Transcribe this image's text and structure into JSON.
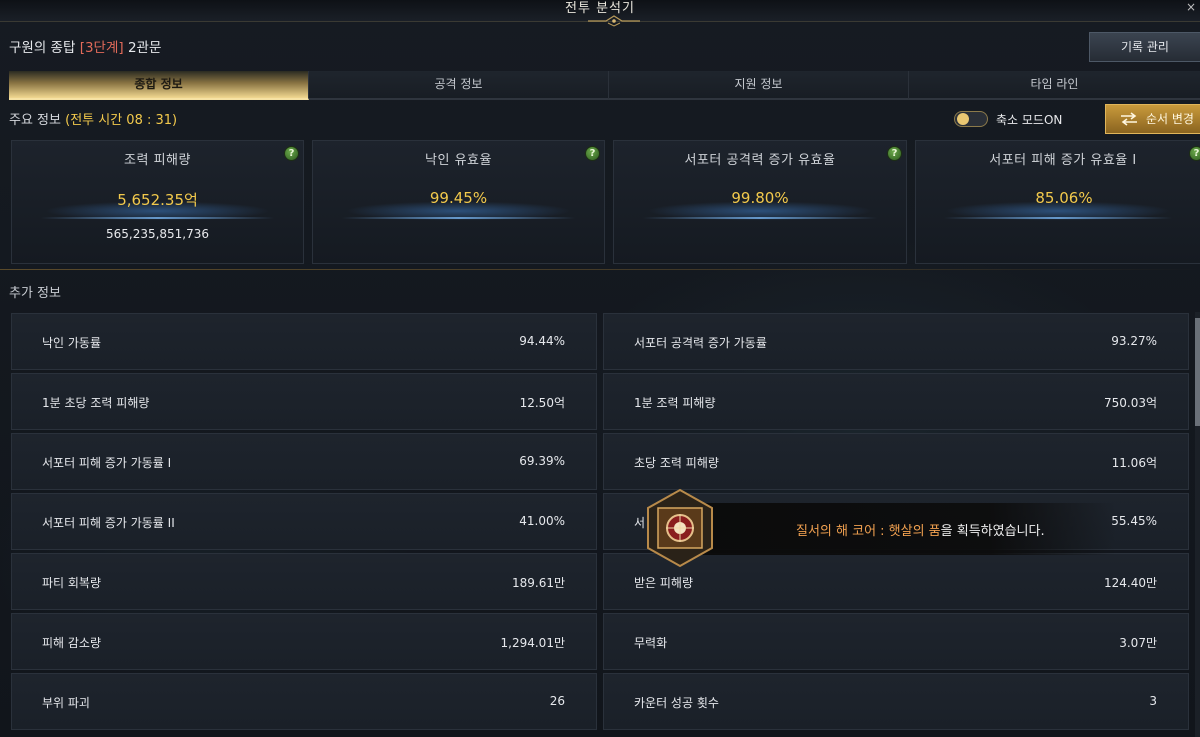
{
  "window": {
    "title": "전투 분석기",
    "close_label": "×"
  },
  "header": {
    "dungeon_name": "구원의 종탑",
    "dungeon_stage": "[3단계]",
    "dungeon_gate": "2관문",
    "record_button": "기록 관리"
  },
  "tabs": [
    {
      "label": "종합 정보",
      "active": true
    },
    {
      "label": "공격 정보",
      "active": false
    },
    {
      "label": "지원 정보",
      "active": false
    },
    {
      "label": "타임 라인",
      "active": false
    }
  ],
  "main_info": {
    "label": "주요 정보",
    "battle_time": "(전투 시간 08 : 31)",
    "toggle_label": "축소 모드ON",
    "toggle_on": true,
    "order_button": "순서 변경"
  },
  "stat_cards": [
    {
      "title": "조력 피해량",
      "value": "5,652.35억",
      "sub": "565,235,851,736"
    },
    {
      "title": "낙인 유효율",
      "value": "99.45%",
      "sub": ""
    },
    {
      "title": "서포터 공격력 증가 유효율",
      "value": "99.80%",
      "sub": ""
    },
    {
      "title": "서포터 피해 증가 유효율 I",
      "value": "85.06%",
      "sub": ""
    }
  ],
  "help_glyph": "?",
  "extra_info": {
    "label": "추가 정보",
    "left": [
      {
        "label": "낙인 가동률",
        "value": "94.44%"
      },
      {
        "label": "1분 초당 조력 피해량",
        "value": "12.50억"
      },
      {
        "label": "서포터 피해 증가 가동률 I",
        "value": "69.39%"
      },
      {
        "label": "서포터 피해 증가 가동률 II",
        "value": "41.00%"
      },
      {
        "label": "파티 회복량",
        "value": "189.61만"
      },
      {
        "label": "피해 감소량",
        "value": "1,294.01만"
      },
      {
        "label": "부위 파괴",
        "value": "26"
      }
    ],
    "right": [
      {
        "label": "서포터 공격력 증가 가동률",
        "value": "93.27%"
      },
      {
        "label": "1분 조력 피해량",
        "value": "750.03억"
      },
      {
        "label": "초당 조력 피해량",
        "value": "11.06억"
      },
      {
        "label": "서",
        "value": "55.45%"
      },
      {
        "label": "받은 피해량",
        "value": "124.40만"
      },
      {
        "label": "무력화",
        "value": "3.07만"
      },
      {
        "label": "카운터 성공 횟수",
        "value": "3"
      }
    ]
  },
  "notification": {
    "item_name": "질서의 해 코어 : 햇살의 품",
    "suffix": "을 획득하였습니다."
  },
  "colors": {
    "accent_gold": "#f2c94c",
    "stage_red": "#e26a5a",
    "item_orange": "#f0a050",
    "help_green": "#6aa84a"
  }
}
